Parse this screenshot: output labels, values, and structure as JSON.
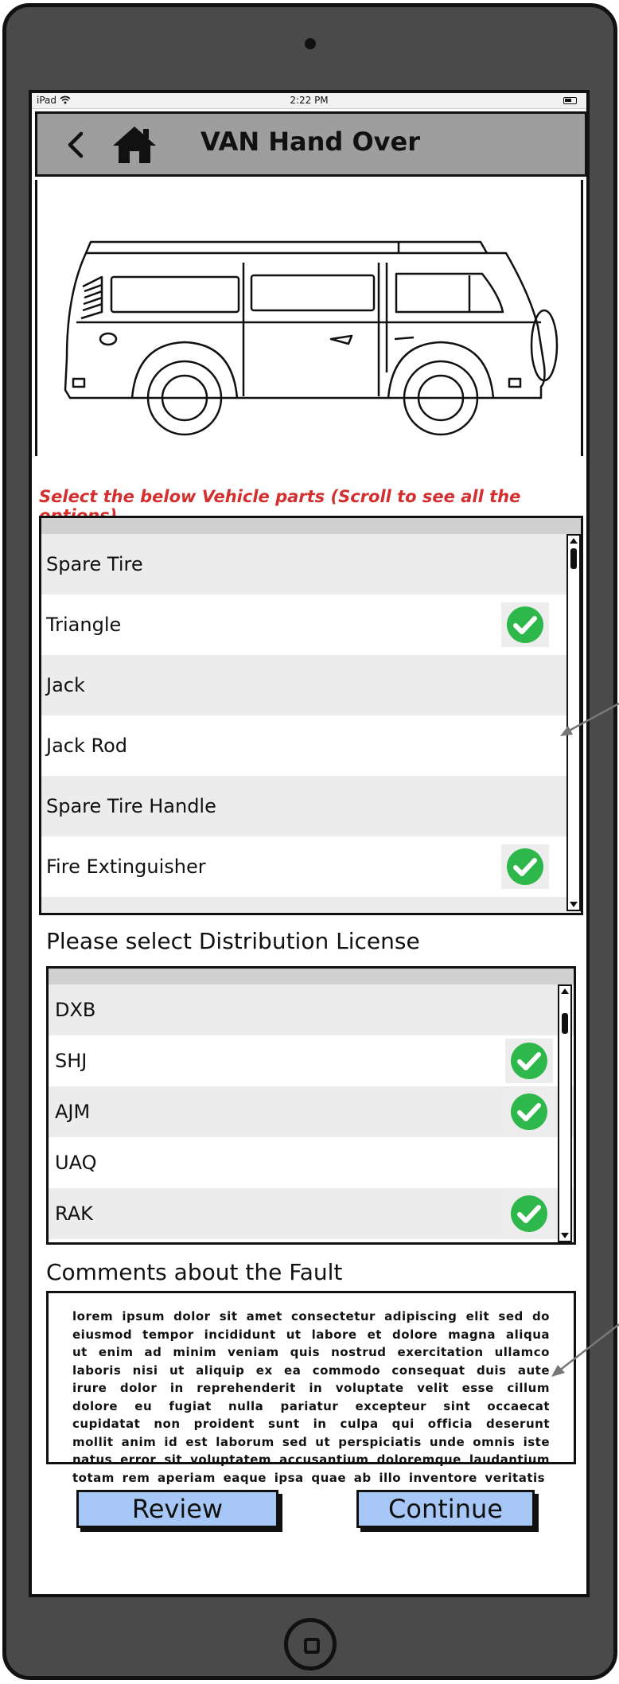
{
  "status_bar": {
    "carrier": "iPad",
    "time": "2:22 PM"
  },
  "nav": {
    "title": "VAN Hand Over"
  },
  "parts": {
    "instruction": "Select the below Vehicle parts  (Scroll to see all the options)",
    "items": [
      {
        "label": "Spare Tire",
        "checked": false
      },
      {
        "label": "Triangle",
        "checked": true
      },
      {
        "label": "Jack",
        "checked": false
      },
      {
        "label": "Jack Rod",
        "checked": false
      },
      {
        "label": "Spare Tire Handle",
        "checked": false
      },
      {
        "label": "Fire Extinguisher",
        "checked": true
      }
    ]
  },
  "license": {
    "heading": "Please select Distribution License",
    "items": [
      {
        "label": "DXB",
        "checked": false
      },
      {
        "label": "SHJ",
        "checked": true
      },
      {
        "label": "AJM",
        "checked": true
      },
      {
        "label": "UAQ",
        "checked": false
      },
      {
        "label": "RAK",
        "checked": true
      }
    ]
  },
  "comments": {
    "heading": "Comments about the Fault",
    "placeholder": "lorem ipsum dolor sit amet consectetur adipiscing elit sed do eiusmod tempor incididunt ut labore et dolore magna aliqua ut enim ad minim veniam quis nostrud exercitation ullamco laboris nisi ut aliquip ex ea commodo consequat duis aute irure dolor in reprehenderit in voluptate velit esse cillum dolore eu fugiat nulla pariatur excepteur sint occaecat cupidatat non proident sunt in culpa qui officia deserunt mollit anim id est laborum sed ut perspiciatis unde omnis iste natus error sit voluptatem accusantium doloremque laudantium totam rem aperiam eaque ipsa quae ab illo inventore veritatis"
  },
  "buttons": {
    "review": "Review",
    "continue": "Continue"
  },
  "colors": {
    "device": "#4a4a4a",
    "navbar": "#9e9e9e",
    "instruction_text": "#d32f2f",
    "check_green": "#2eb84b",
    "row_shade": "#ececec",
    "button_fill": "#a7c8f7"
  },
  "icons": {
    "back": "chevron-left-icon",
    "home": "home-icon",
    "check": "check-circle-icon",
    "battery": "battery-icon",
    "wifi": "wifi-icon"
  }
}
